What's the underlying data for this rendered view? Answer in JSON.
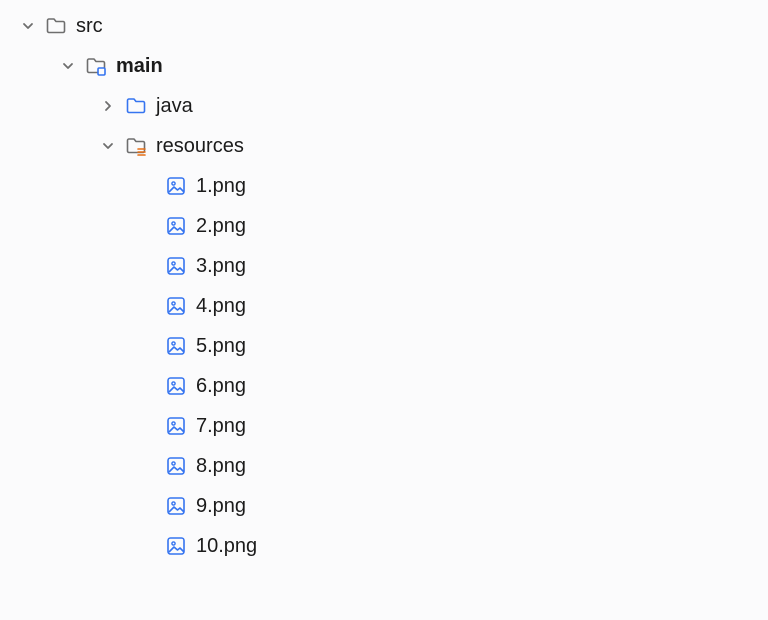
{
  "tree": {
    "src": {
      "label": "src",
      "expanded": true
    },
    "main": {
      "label": "main",
      "expanded": true
    },
    "java": {
      "label": "java",
      "expanded": false
    },
    "resources": {
      "label": "resources",
      "expanded": true
    },
    "files": [
      {
        "label": "1.png"
      },
      {
        "label": "2.png"
      },
      {
        "label": "3.png"
      },
      {
        "label": "4.png"
      },
      {
        "label": "5.png"
      },
      {
        "label": "6.png"
      },
      {
        "label": "7.png"
      },
      {
        "label": "8.png"
      },
      {
        "label": "9.png"
      },
      {
        "label": "10.png"
      }
    ]
  },
  "colors": {
    "chevron": "#6e6e6e",
    "folderGray": "#6e6e6e",
    "folderBlue": "#3574f0",
    "resourceOrange": "#e66e14",
    "imageBlue": "#3574f0"
  }
}
